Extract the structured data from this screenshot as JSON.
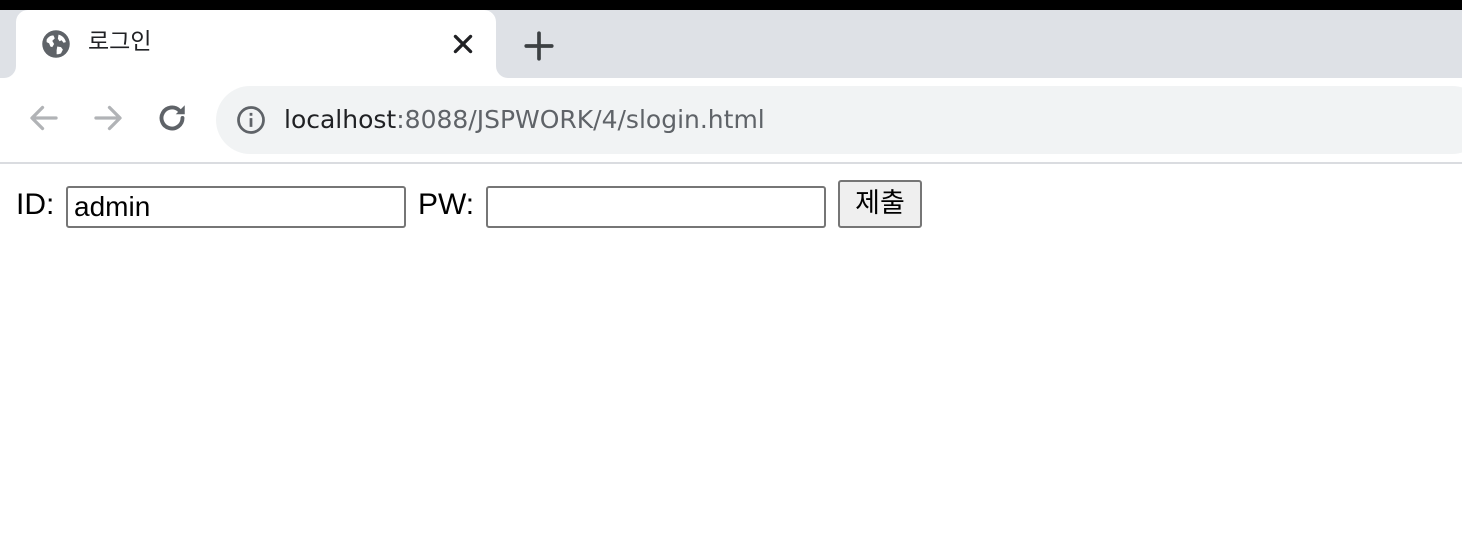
{
  "browser": {
    "tab": {
      "title": "로그인",
      "favicon": "globe-icon",
      "close_icon": "close-icon"
    },
    "new_tab_icon": "plus-icon",
    "nav": {
      "back_icon": "arrow-left-icon",
      "forward_icon": "arrow-right-icon",
      "reload_icon": "reload-icon"
    },
    "address": {
      "info_icon": "info-icon",
      "host": "localhost",
      "rest": ":8088/JSPWORK/4/slogin.html"
    },
    "colors": {
      "tab_strip": "#dee1e6",
      "omnibox": "#f1f3f4",
      "icon": "#5f6368",
      "text": "#202124"
    }
  },
  "form": {
    "id_label": "ID:",
    "id_value": "admin",
    "pw_label": "PW:",
    "pw_value": "",
    "submit_label": "제출"
  }
}
